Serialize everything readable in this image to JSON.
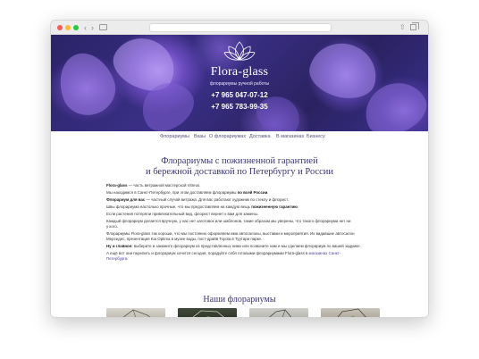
{
  "hero": {
    "brand": "Flora-glass",
    "tagline": "флорариумы ручной работы",
    "phone1": "+7 965 047-07-12",
    "phone2": "+7 965 783-99-35"
  },
  "menu": {
    "items": [
      "Флорариумы",
      "Вазы",
      "О флорариумах",
      "Доставка",
      "В магазинах",
      "Бизнесу"
    ]
  },
  "main": {
    "title_line1": "Флорариумы с пожизненной гарантией",
    "title_line2": "и бережной доставкой по Петербургу и России",
    "paragraphs": [
      {
        "bold": "Flora-glass",
        "text": " — часть витражной мастерской Vitreus."
      },
      {
        "pre": "Мы находимся в Санкт-Петербурге, при этом доставляем флорариумы ",
        "bold": "по всей России",
        "post": "."
      },
      {
        "bold": "Флорариум для вас",
        "text": " — частный случай витража. Для вас работают художник по стеклу и флорист."
      },
      {
        "pre": "Швы флорариума настолько прочные, что мы предоставляем на каждую вещь ",
        "bold": "пожизненную гарантию",
        "post": "."
      },
      {
        "text": "Если растения потеряли привлекательный вид, флорист вернет к вам для замены."
      },
      {
        "text": "Каждый флорариум делается вручную, у нас нет заготовок или шаблонов, такие образом мы уверены, что такого флорариума нет ни"
      },
      {
        "text": "у кого."
      },
      {
        "text": "Флорариумы Flora-glass так хороши, что мы постоянно оформляем ими автосалоны, выставки и мероприятия. Их видавшие автосалон"
      },
      {
        "text": "Мерседес, презентация Kia Optima в музее воды, пост-драйв Toyota в Туутари парке."
      },
      {
        "bold": "Ну и главное:",
        "text": " выберите и закажите флорариум из представленных ниже или позвоните нам и мы сделаем флорариум по вашей задумке."
      },
      {
        "pre": "А ещё вот они перепить и флорариум хочется сегодня, порадуйте себя готовыми флорариумами Flora-glass в ",
        "link": "магазинах Санкт-"
      },
      {
        "link": "Петербурга",
        "post": "."
      }
    ],
    "section_title": "Наши флорариумы"
  },
  "colors": {
    "heading": "#3a3478",
    "menu_text": "#55507a",
    "link": "#4a3fa0"
  }
}
